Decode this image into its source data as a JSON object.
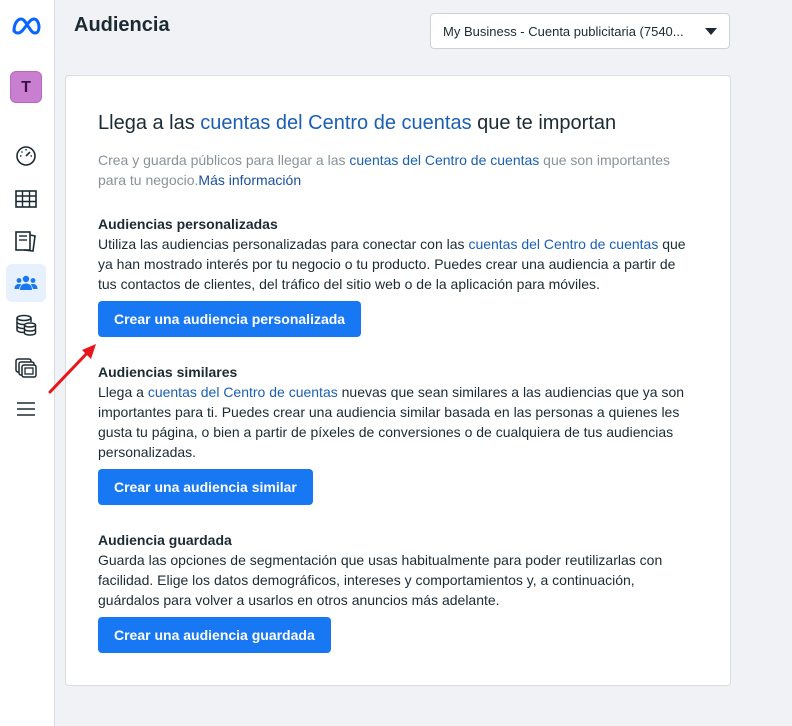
{
  "header": {
    "title": "Audiencia",
    "account_select": "My Business - Cuenta publicitaria (7540..."
  },
  "sidebar": {
    "avatar_letter": "T",
    "items": [
      {
        "icon": "dashboard-icon"
      },
      {
        "icon": "table-icon"
      },
      {
        "icon": "pages-icon"
      },
      {
        "icon": "audience-icon",
        "active": true
      },
      {
        "icon": "database-icon"
      },
      {
        "icon": "ads-icon"
      },
      {
        "icon": "menu-icon"
      }
    ]
  },
  "intro": {
    "title_pre": "Llega a las ",
    "title_link": "cuentas del Centro de cuentas",
    "title_post": " que te importan",
    "sub_pre": "Crea y guarda públicos para llegar a las ",
    "sub_link": "cuentas del Centro de cuentas",
    "sub_post": " que son importantes para tu negocio.",
    "sub_more": "Más información"
  },
  "custom": {
    "heading": "Audiencias personalizadas",
    "text_pre": "Utiliza las audiencias personalizadas para conectar con las ",
    "text_link": "cuentas del Centro de cuentas",
    "text_post": " que ya han mostrado interés por tu negocio o tu producto. Puedes crear una audiencia a partir de tus contactos de clientes, del tráfico del sitio web o de la aplicación para móviles.",
    "button": "Crear una audiencia personalizada"
  },
  "similar": {
    "heading": "Audiencias similares",
    "text_pre": "Llega a ",
    "text_link": "cuentas del Centro de cuentas",
    "text_post": " nuevas que sean similares a las audiencias que ya son importantes para ti. Puedes crear una audiencia similar basada en las personas a quienes les gusta tu página, o bien a partir de píxeles de conversiones o de cualquiera de tus audiencias personalizadas.",
    "button": "Crear una audiencia similar"
  },
  "saved": {
    "heading": "Audiencia guardada",
    "text": "Guarda las opciones de segmentación que usas habitualmente para poder reutilizarlas con facilidad. Elige los datos demográficos, intereses y comportamientos y, a continuación, guárdalos para volver a usarlos en otros anuncios más adelante.",
    "button": "Crear una audiencia guardada"
  },
  "colors": {
    "primary": "#1877f2",
    "link": "#1a5fb4",
    "annotation_arrow": "#e8161b"
  }
}
